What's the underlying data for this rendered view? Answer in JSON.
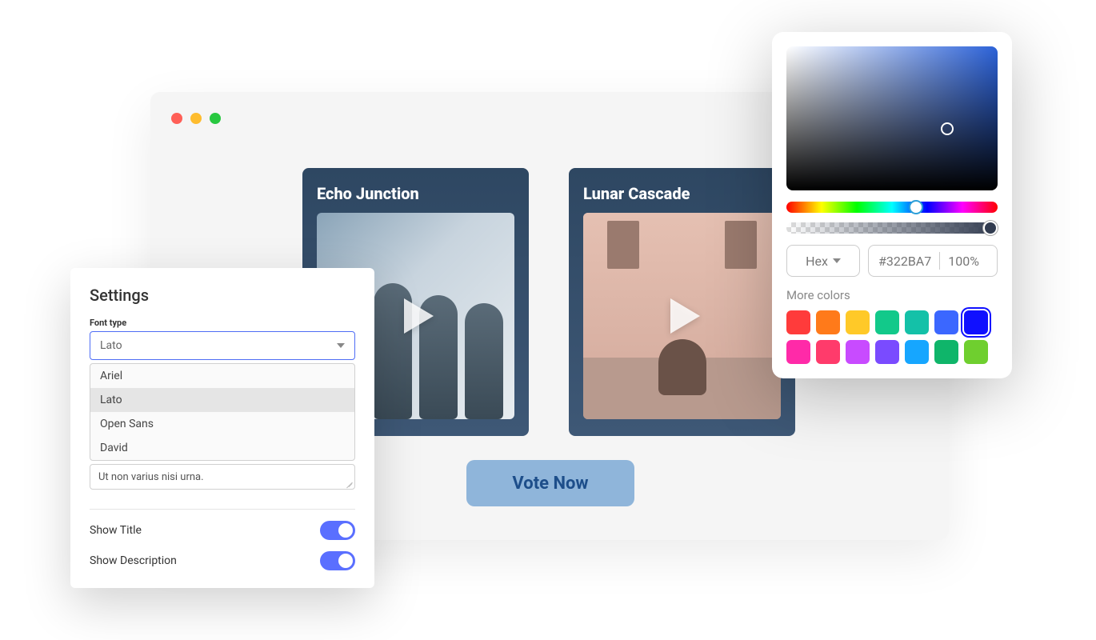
{
  "browser": {
    "cards": [
      {
        "title": "Echo Junction"
      },
      {
        "title": "Lunar Cascade"
      }
    ],
    "vote_label": "Vote Now"
  },
  "settings": {
    "title": "Settings",
    "font_type_label": "Font type",
    "font_selected": "Lato",
    "font_options": [
      "Ariel",
      "Lato",
      "Open Sans",
      "David"
    ],
    "description_value": "Ut non varius nisi urna.",
    "toggles": [
      {
        "label": "Show Title",
        "on": true
      },
      {
        "label": "Show Description",
        "on": true
      }
    ]
  },
  "picker": {
    "format_label": "Hex",
    "hex_value": "#322BA7",
    "opacity": "100%",
    "more_label": "More colors",
    "swatches_row1": [
      "#ff3b3b",
      "#ff7a1a",
      "#ffc928",
      "#12c98a",
      "#14c1a8",
      "#3b67ff",
      "#1010ff"
    ],
    "swatches_row2": [
      "#ff2aa8",
      "#ff3b6b",
      "#c84bff",
      "#7a4bff",
      "#16a6ff",
      "#0fb56a",
      "#6fcf2f"
    ],
    "selected_swatch": "#1010ff"
  }
}
